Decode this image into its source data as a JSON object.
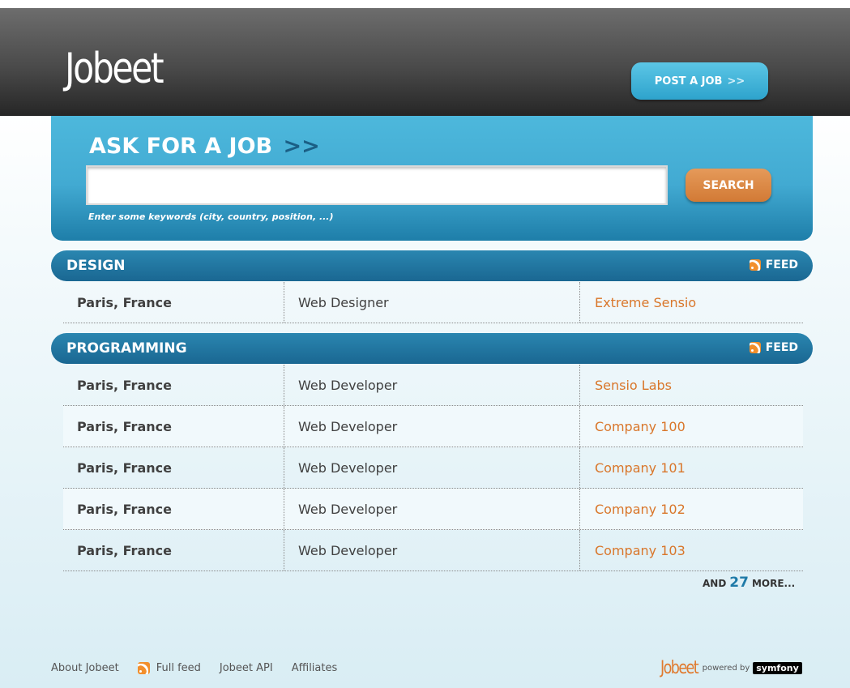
{
  "header": {
    "logo": "Jobeet",
    "post_job_label": "POST A JOB",
    "post_job_arrows": ">>"
  },
  "search": {
    "title": "ASK FOR A JOB",
    "title_arrows": ">>",
    "input_value": "",
    "button_label": "SEARCH",
    "help": "Enter some keywords (city, country, position, ...)"
  },
  "categories": [
    {
      "name": "DESIGN",
      "feed_label": "FEED",
      "jobs": [
        {
          "location": "Paris, France",
          "position": "Web Designer",
          "company": "Extreme Sensio"
        }
      ]
    },
    {
      "name": "PROGRAMMING",
      "feed_label": "FEED",
      "jobs": [
        {
          "location": "Paris, France",
          "position": "Web Developer",
          "company": "Sensio Labs"
        },
        {
          "location": "Paris, France",
          "position": "Web Developer",
          "company": "Company 100"
        },
        {
          "location": "Paris, France",
          "position": "Web Developer",
          "company": "Company 101"
        },
        {
          "location": "Paris, France",
          "position": "Web Developer",
          "company": "Company 102"
        },
        {
          "location": "Paris, France",
          "position": "Web Developer",
          "company": "Company 103"
        }
      ],
      "more_prefix": "AND",
      "more_count": "27",
      "more_suffix": "MORE..."
    }
  ],
  "footer": {
    "links": [
      "About Jobeet",
      "Full feed",
      "Jobeet API",
      "Affiliates"
    ],
    "logo": "Jobeet",
    "powered_by": "powered by",
    "symfony": "symfony"
  },
  "colors": {
    "accent_blue": "#2a86b0",
    "accent_orange": "#d9762a",
    "header_dark": "#3a3a3a"
  },
  "icons": [
    "rss-icon"
  ]
}
